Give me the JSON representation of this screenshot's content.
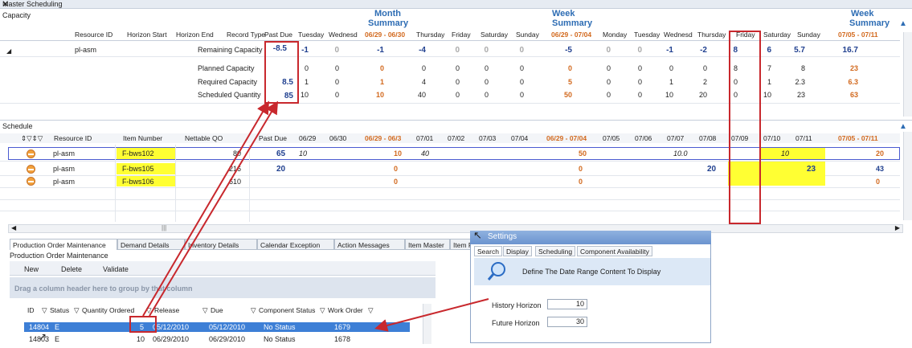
{
  "panel": {
    "title": "Master Scheduling",
    "pin": "✕"
  },
  "capacity": {
    "label": "Capacity",
    "group_month": "Month",
    "group_month_sub": "Summary",
    "group_week1": "Week",
    "group_week1_sub": "Summary",
    "group_week2": "Week",
    "group_week2_sub": "Summary",
    "headers": [
      "Resource ID",
      "Horizon Start",
      "Horizon End",
      "Record Type",
      "Past Due",
      "Tuesday",
      "Wednesd",
      "06/29 - 06/30",
      "Thursday",
      "Friday",
      "Saturday",
      "Sunday",
      "06/29 - 07/04",
      "Monday",
      "Tuesday",
      "Wednesd",
      "Thursday",
      "Friday",
      "Saturday",
      "Sunday",
      "07/05 - 07/11"
    ],
    "resource": "pl-asm",
    "rows": [
      {
        "type": "Remaining Capacity",
        "past_due": "-8.5",
        "vals": [
          "-1",
          "0",
          "-1",
          "-4",
          "0",
          "0",
          "0",
          "-5",
          "0",
          "0",
          "-1",
          "-2",
          "8",
          "6",
          "5.7",
          "16.7"
        ]
      },
      {
        "type": "Planned Capacity",
        "past_due": "",
        "vals": [
          "0",
          "0",
          "0",
          "0",
          "0",
          "0",
          "0",
          "0",
          "0",
          "0",
          "0",
          "0",
          "8",
          "7",
          "8",
          "23"
        ]
      },
      {
        "type": "Required Capacity",
        "past_due": "8.5",
        "vals": [
          "1",
          "0",
          "1",
          "4",
          "0",
          "0",
          "0",
          "5",
          "0",
          "0",
          "1",
          "2",
          "0",
          "1",
          "2.3",
          "6.3"
        ]
      },
      {
        "type": "Scheduled Quantity",
        "past_due": "85",
        "vals": [
          "10",
          "0",
          "10",
          "40",
          "0",
          "0",
          "0",
          "50",
          "0",
          "0",
          "10",
          "20",
          "0",
          "10",
          "23",
          "63"
        ]
      }
    ]
  },
  "schedule": {
    "label": "Schedule",
    "headers": [
      "Resource ID",
      "Item Number",
      "Nettable QO",
      "Past Due",
      "06/29",
      "06/30",
      "06/29 - 06/3",
      "07/01",
      "07/02",
      "07/03",
      "07/04",
      "06/29 - 07/04",
      "07/05",
      "07/06",
      "07/07",
      "07/08",
      "07/09",
      "07/10",
      "07/11",
      "07/05 - 07/11"
    ],
    "rows": [
      {
        "resource": "pl-asm",
        "item": "F-bws102",
        "qo": "80",
        "past_due": "65",
        "c1": "10",
        "c2": "10",
        "c3": "40",
        "c4": "50",
        "c5": "10.0",
        "c6": "10",
        "c7": "20"
      },
      {
        "resource": "pl-asm",
        "item": "F-bws105",
        "qo": "216",
        "past_due": "20",
        "c2": "0",
        "c4": "0",
        "c5": "20",
        "c6": "23",
        "c7": "43"
      },
      {
        "resource": "pl-asm",
        "item": "F-bws106",
        "qo": "610",
        "past_due": "",
        "c2": "0",
        "c4": "0",
        "c7": "0"
      }
    ]
  },
  "bottom_tabs": [
    "Production Order Maintenance",
    "Demand Details",
    "Inventory Details",
    "Calendar Exception",
    "Action Messages",
    "Item Master",
    "Item Pla"
  ],
  "pom": {
    "title": "Production Order Maintenance",
    "toolbar": [
      "New",
      "Delete",
      "Validate"
    ],
    "group_hint": "Drag a column header here to group by that column",
    "headers": [
      "ID",
      "Status",
      "Quantity Ordered",
      "Release",
      "Due",
      "Component Status",
      "Work Order"
    ],
    "rows": [
      {
        "id": "14804",
        "status": "E",
        "qty": "5",
        "release": "05/12/2010",
        "due": "05/12/2010",
        "comp": "No Status",
        "wo": "1679"
      },
      {
        "id": "14803",
        "status": "E",
        "qty": "10",
        "release": "06/29/2010",
        "due": "06/29/2010",
        "comp": "No Status",
        "wo": "1678"
      }
    ]
  },
  "settings": {
    "title": "Settings",
    "tabs": [
      "Search",
      "Display",
      "Scheduling",
      "Component Availability"
    ],
    "hint": "Define The Date Range Content To Display",
    "history_label": "History Horizon",
    "history_value": "10",
    "future_label": "Future Horizon",
    "future_value": "30"
  },
  "colors": {
    "accent": "#2e6db4",
    "highlight": "#ffff33",
    "annotation": "#c8282d",
    "selection": "#3d7fd6"
  }
}
